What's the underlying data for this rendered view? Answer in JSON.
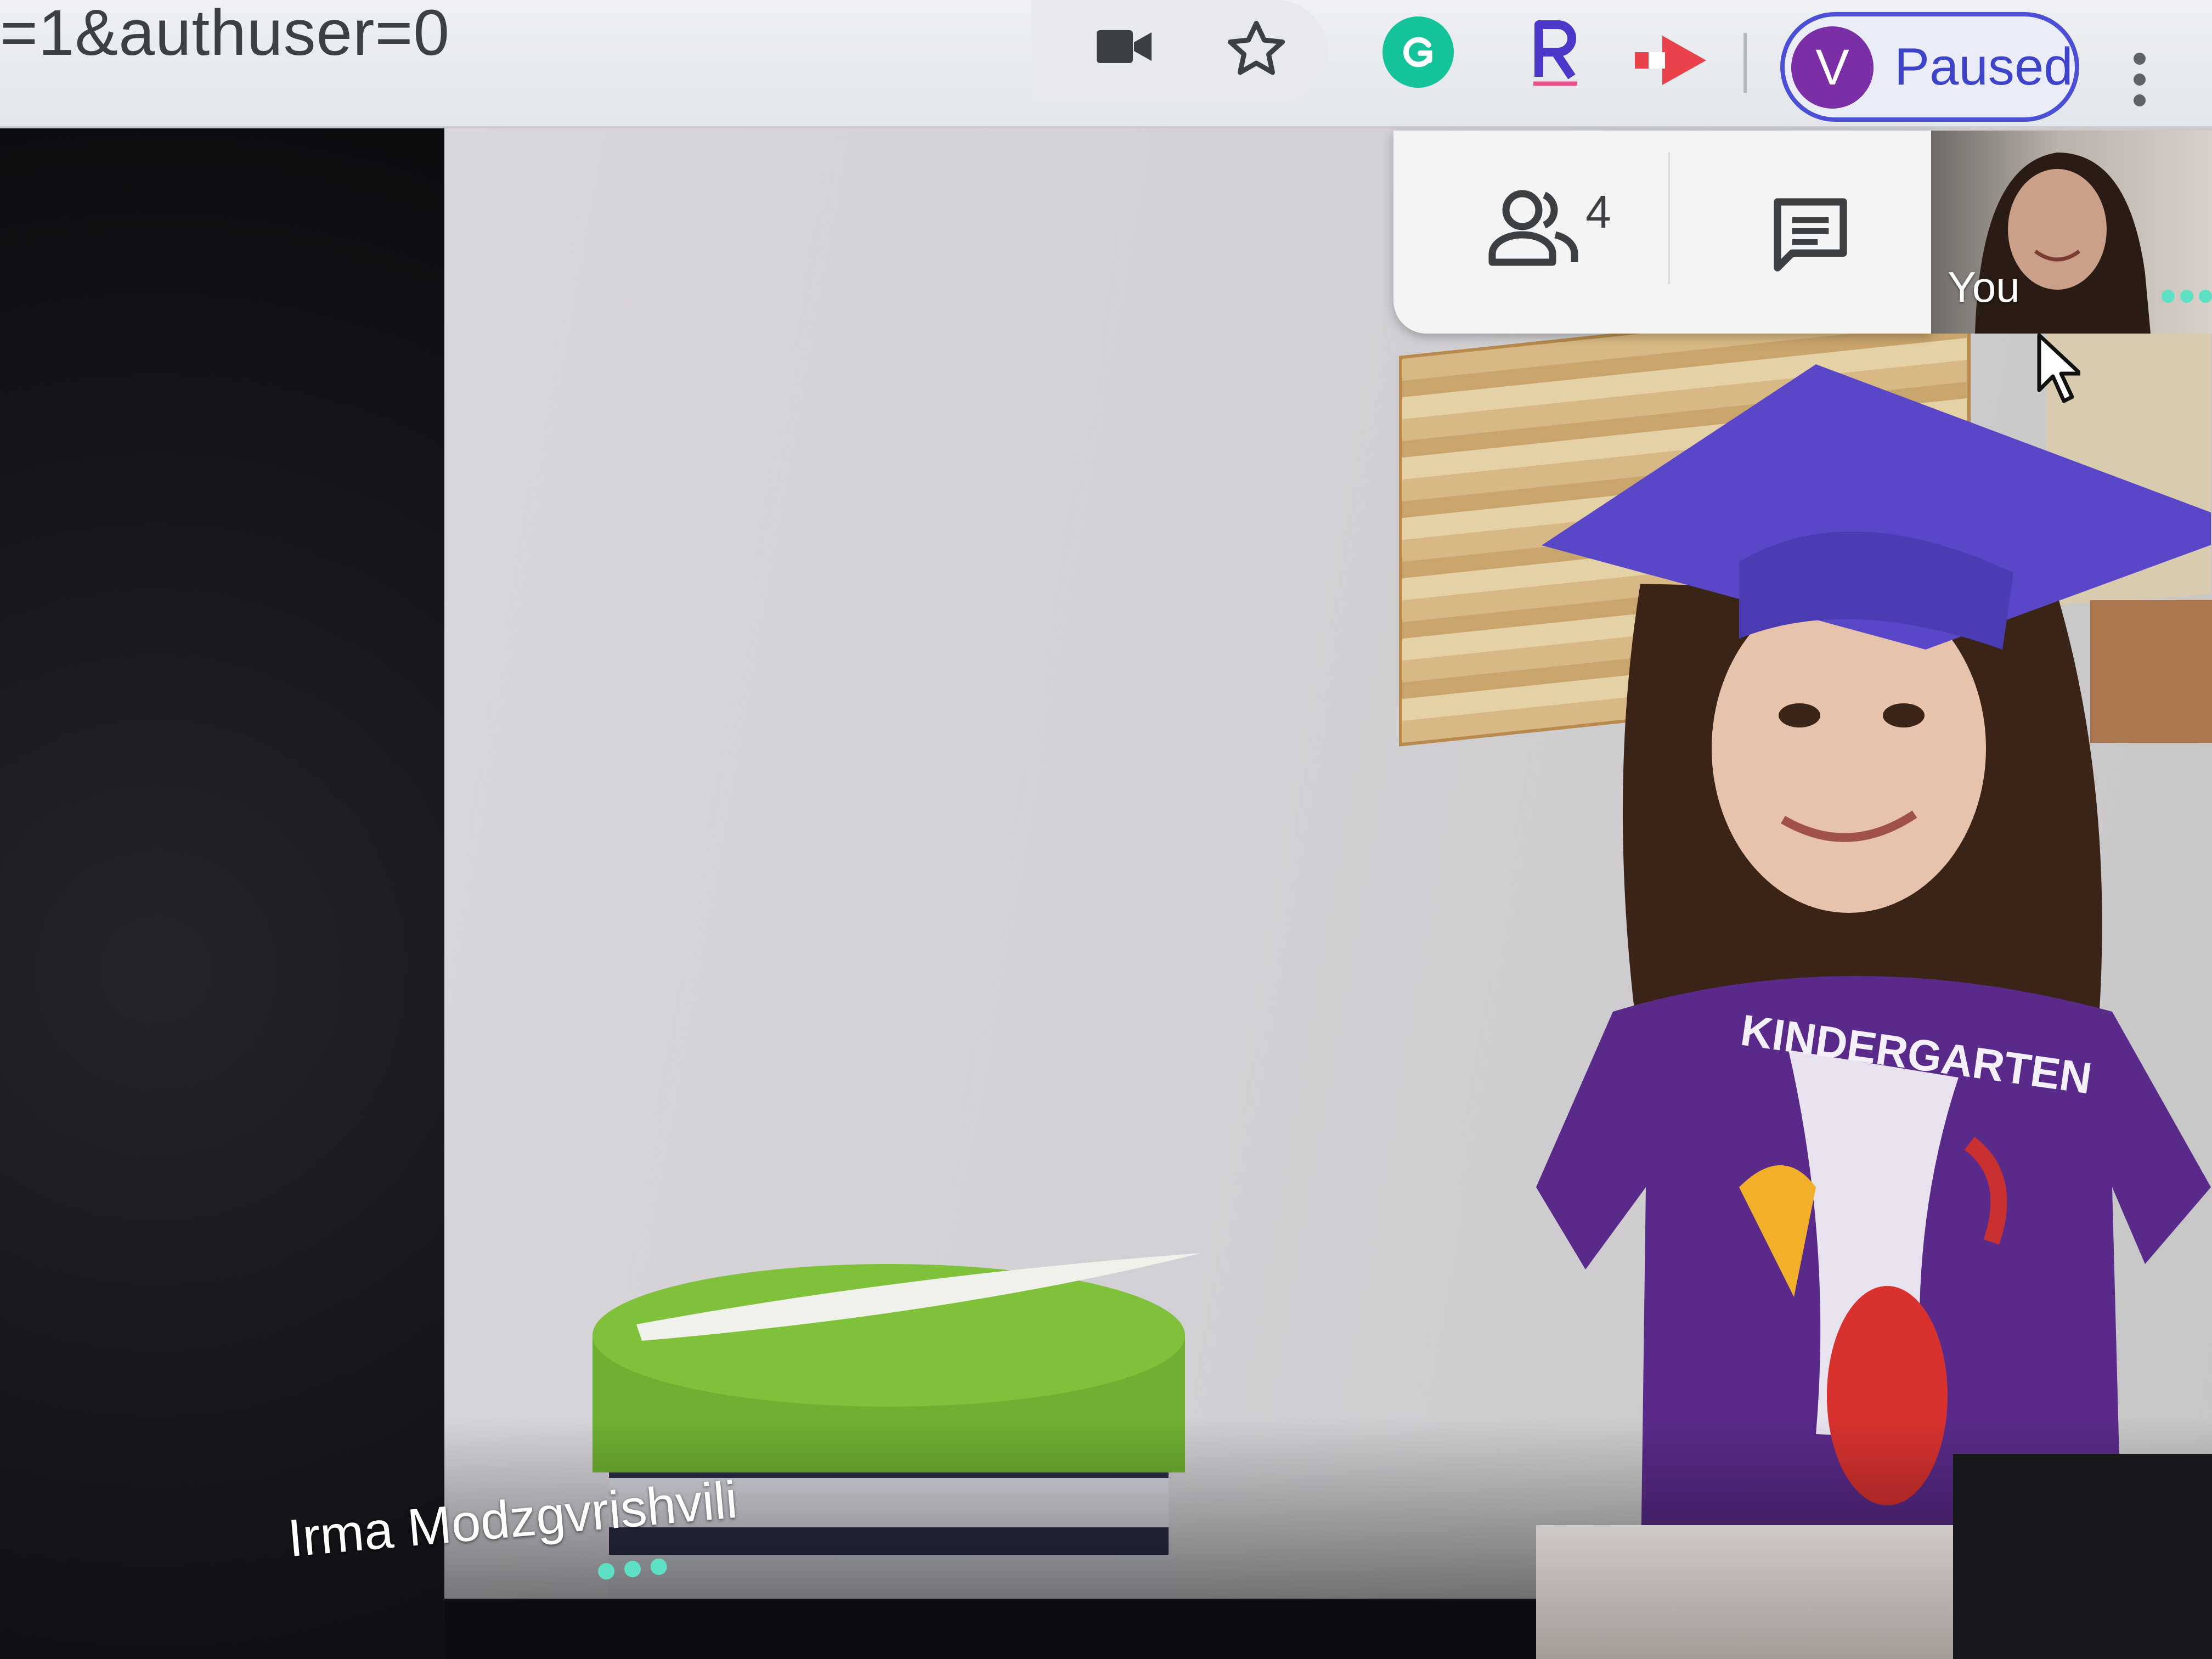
{
  "browser": {
    "url_fragment": "=1&authuser=0",
    "toolbar_icons": [
      "camera-icon",
      "star-icon",
      "grammarly-icon",
      "reader-icon",
      "share-icon",
      "menu-icon"
    ],
    "profile": {
      "avatar_letter": "V",
      "status_label": "Paused",
      "accent_color": "#4b4fd6",
      "avatar_color": "#7b2fa6"
    }
  },
  "meeting": {
    "controls": {
      "people_count": "4",
      "people_icon": "people-icon",
      "chat_icon": "chat-icon"
    },
    "self_view": {
      "label": "You"
    },
    "main_participant": {
      "name": "Irma Modzgvrishvili",
      "shirt_text": "KINDERGARTEN"
    },
    "speaking_indicator_color": "#5de0c4"
  }
}
